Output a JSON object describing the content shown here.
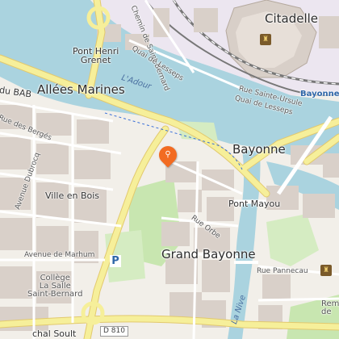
{
  "map": {
    "district_labels": {
      "citadelle": "Citadelle",
      "bayonne": "Bayonne",
      "allees_marines": "Allées Marines",
      "grand_bayonne": "Grand Bayonne",
      "ville_en_bois": "Ville en Bois"
    },
    "bridge_labels": {
      "pont_henri_grenet": "Pont Henri\nGrenet",
      "pont_mayou": "Pont Mayou"
    },
    "river_labels": {
      "adour": "L'Adour",
      "nive": "La Nive"
    },
    "street_labels": {
      "chemin_saint_bernard": "Chemin de Saint-Bernard",
      "quai_lesseps_upper": "Quai de Lesseps",
      "quai_lesseps_lower": "Quai de Lesseps",
      "rue_sainte_ursule": "Rue Sainte-Ursule",
      "du_bab": "du BAB",
      "rue_des_berges": "Rue des Bergés",
      "avenue_dubrocq": "Avenue Dubrocq",
      "avenue_de_marhum": "Avenue de Marhum",
      "rue_orbe": "Rue Orbe",
      "rue_pannecau": "Rue Pannecau",
      "marechal_soult": "chal Soult",
      "rail_line": "Rail"
    },
    "poi_labels": {
      "college": "Collège\nLa Salle\nSaint-Bernard",
      "bayonne_station": "Bayonne",
      "remparts": "Remp\nde",
      "parking": "P"
    },
    "road_shields": {
      "d810": "D 810"
    },
    "icons": {
      "location_marker": "location-marker-icon",
      "castle_citadelle": "castle-icon",
      "castle_remparts": "castle-icon",
      "parking": "parking-icon"
    },
    "colors": {
      "water": "#aad3df",
      "park": "#c8e6b0",
      "major_road": "#f6ef9a",
      "marker": "#f26b21",
      "railway": "#777777",
      "station": "#2f66a8"
    }
  }
}
